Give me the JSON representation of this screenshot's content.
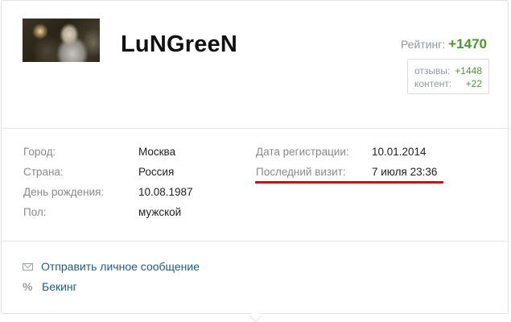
{
  "profile": {
    "username": "LuNGreeN",
    "avatar_icon": "user-avatar-photo"
  },
  "rating": {
    "label": "Рейтинг:",
    "value": "+1470",
    "reviews_label": "отзывы:",
    "reviews_value": "+1448",
    "content_label": "контент:",
    "content_value": "+22",
    "accent_color": "#4a9a2a"
  },
  "info_left": [
    {
      "label": "Город:",
      "value": "Москва"
    },
    {
      "label": "Страна:",
      "value": "Россия"
    },
    {
      "label": "День рождения:",
      "value": "10.08.1987"
    },
    {
      "label": "Пол:",
      "value": "мужской"
    }
  ],
  "info_right": [
    {
      "label": "Дата регистрации:",
      "value": "10.01.2014"
    },
    {
      "label": "Последний визит:",
      "value": "7 июля 23:36"
    }
  ],
  "highlight_color": "#d8000c",
  "actions": {
    "send_message": "Отправить личное сообщение",
    "send_message_icon": "envelope-icon",
    "backing": "Бекинг",
    "backing_icon": "percent-icon",
    "link_color": "#1f5d82"
  }
}
